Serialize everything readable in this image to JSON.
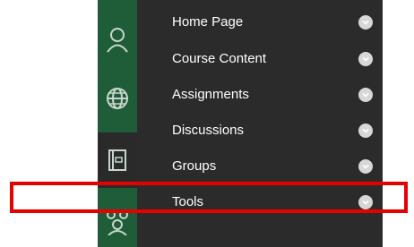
{
  "menu": {
    "items": [
      {
        "label": "Home Page"
      },
      {
        "label": "Course Content"
      },
      {
        "label": "Assignments"
      },
      {
        "label": "Discussions"
      },
      {
        "label": "Groups"
      },
      {
        "label": "Tools"
      }
    ]
  },
  "rail": {
    "icons": [
      "person-icon",
      "globe-icon",
      "course-icon",
      "groups-icon"
    ]
  },
  "colors": {
    "rail_green": "#1f5c38",
    "menu_bg": "#2b2b2b",
    "highlight_red": "#e60000",
    "chevron_bg": "#d7d7d7"
  }
}
